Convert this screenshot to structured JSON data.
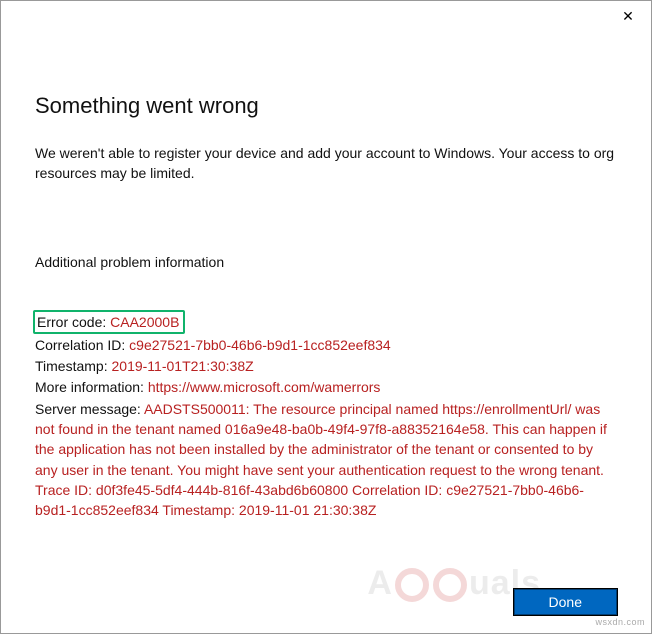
{
  "titlebar": {
    "close_glyph": "✕"
  },
  "heading": "Something went wrong",
  "subtext": "We weren't able to register your device and add your account to Windows. Your access to org resources may be limited.",
  "section_label": "Additional problem information",
  "details": {
    "error_code_label": "Error code: ",
    "error_code_value": "CAA2000B",
    "correlation_label": "Correlation ID: ",
    "correlation_value": "c9e27521-7bb0-46b6-b9d1-1cc852eef834",
    "timestamp_label": "Timestamp: ",
    "timestamp_value": "2019-11-01T21:30:38Z",
    "moreinfo_label": "More information: ",
    "moreinfo_value": "https://www.microsoft.com/wamerrors",
    "server_label": "Server message: ",
    "server_value": "AADSTS500011: The resource principal named https://enrollmentUrl/ was not found in the tenant named 016a9e48-ba0b-49f4-97f8-a88352164e58. This can happen if the application has not been installed by the administrator of the tenant or consented to by any user in the tenant. You might have sent your authentication request to the wrong tenant. Trace ID: d0f3fe45-5df4-444b-816f-43abd6b60800 Correlation ID: c9e27521-7bb0-46b6-b9d1-1cc852eef834 Timestamp: 2019-11-01 21:30:38Z"
  },
  "footer": {
    "done_label": "Done"
  },
  "watermark": "wsxdn.com",
  "brand_left": "A",
  "brand_right": "uals"
}
